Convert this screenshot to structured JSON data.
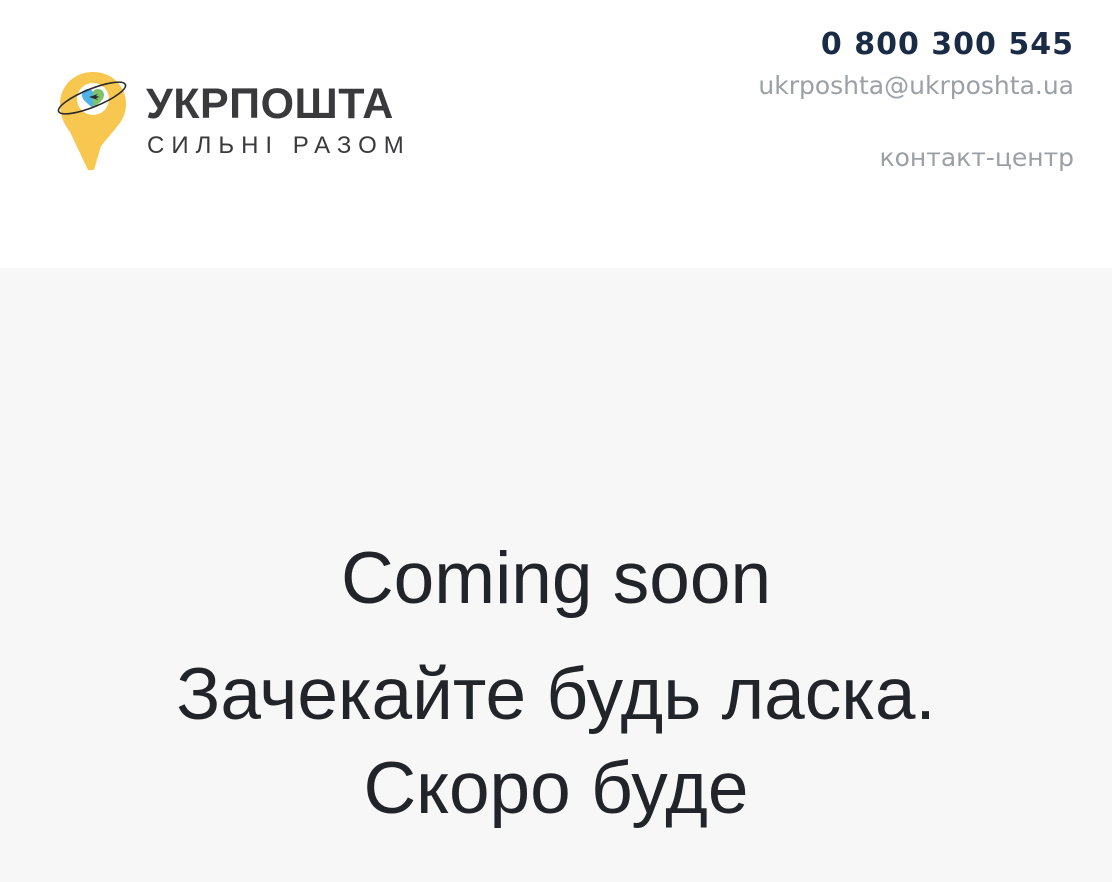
{
  "header": {
    "logo": {
      "name": "УКРПОШТА",
      "tagline": "СИЛЬНІ РАЗОМ",
      "colors": {
        "pin": "#f7c74f",
        "heart_left": "#4fb3e8",
        "heart_right": "#7cc36a",
        "ring": "#2b2b2b",
        "text": "#3a3a3c"
      }
    },
    "contacts": {
      "phone": "0 800 300 545",
      "email": "ukrposhta@ukrposhta.ua",
      "contact_center": "контакт-центр"
    }
  },
  "main": {
    "heading": "Coming soon",
    "message_line1": "Зачекайте будь ласка.",
    "message_line2": "Скоро буде"
  },
  "colors": {
    "header_background": "#ffffff",
    "main_background": "#f7f7f7",
    "phone_text": "#1a2b45",
    "muted_text": "#9aa0a6",
    "heading_text": "#212529"
  }
}
